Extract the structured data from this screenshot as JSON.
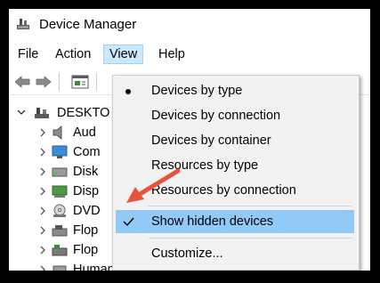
{
  "window": {
    "title": "Device Manager",
    "app_icon": "device-manager-icon"
  },
  "menubar": {
    "items": [
      "File",
      "Action",
      "View",
      "Help"
    ]
  },
  "toolbar": {
    "icons": [
      "back-arrow-icon",
      "forward-arrow-icon",
      "properties-icon"
    ]
  },
  "tree": {
    "root": "DESKTO",
    "children": [
      "Aud",
      "Com",
      "Disk",
      "Disp",
      "DVD",
      "Flop",
      "Flop",
      "Human Interface Device"
    ]
  },
  "view_menu": {
    "items": [
      {
        "label": "Devices by type",
        "state": "selected-radio"
      },
      {
        "label": "Devices by connection"
      },
      {
        "label": "Devices by container"
      },
      {
        "label": "Resources by type"
      },
      {
        "label": "Resources by connection"
      },
      {
        "label": "Show hidden devices",
        "state": "checked",
        "highlighted": true
      },
      {
        "label": "Customize..."
      }
    ]
  },
  "annotation": {
    "color": "#e8533a",
    "points_to": "Show hidden devices"
  }
}
